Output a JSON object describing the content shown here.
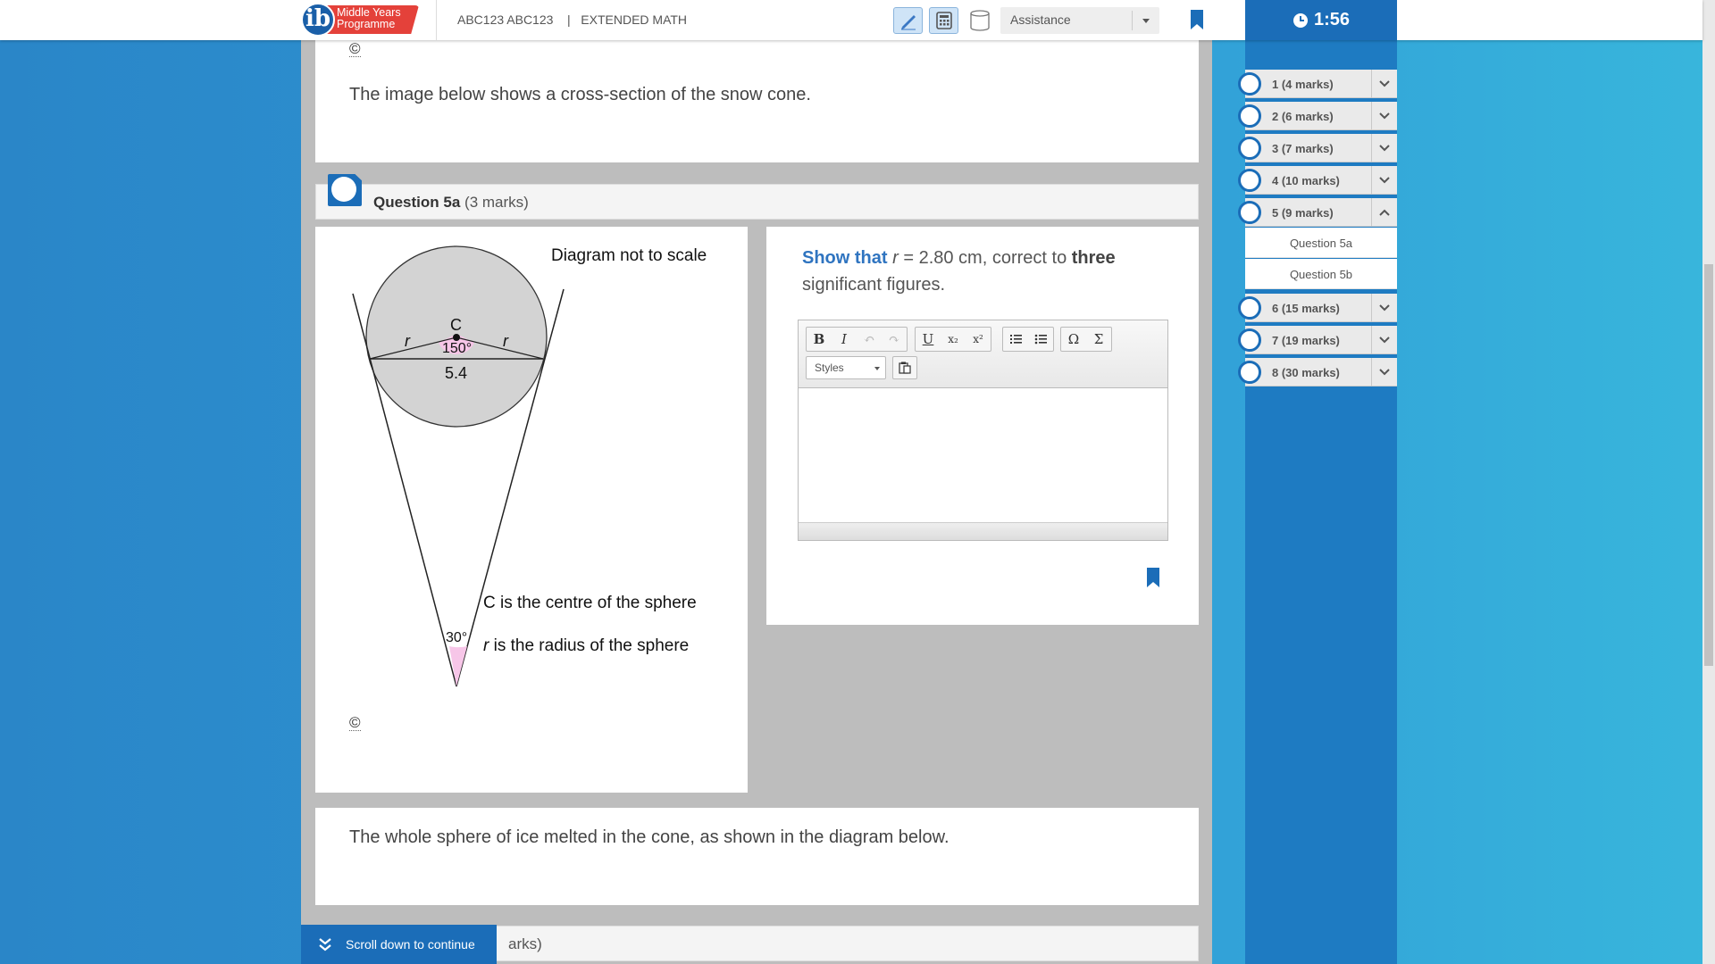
{
  "header": {
    "logo_letter": "ib",
    "logo_text": "Middle Years Programme",
    "candidate": "ABC123 ABC123",
    "separator": "|",
    "subject": "EXTENDED MATH",
    "assistance_label": "Assistance",
    "timer": "1:56",
    "icons": [
      "pen-icon",
      "calculator-icon",
      "formula-booklet-icon",
      "bookmark-icon",
      "clock-icon"
    ]
  },
  "content": {
    "copyright_symbol": "©",
    "intro_text": "The image below shows a cross-section of the snow cone.",
    "question": {
      "title": "Question 5a",
      "marks": "(3 marks)",
      "prompt_show": "Show that",
      "prompt_r": "r",
      "prompt_mid": " = 2.80 cm, correct to ",
      "prompt_bold": "three",
      "prompt_end": " significant figures."
    },
    "diagram": {
      "note": "Diagram not to scale",
      "center_label": "C",
      "radius_label": "r",
      "angle_top": "150°",
      "chord": "5.4",
      "angle_bottom": "30°",
      "legend_c": "C is the centre of the sphere",
      "legend_r_var": "r",
      "legend_r": " is the radius of the sphere"
    },
    "editor": {
      "buttons": [
        "B",
        "I",
        "↶",
        "↷",
        "U",
        "x₂",
        "x²",
        "Ω",
        "Σ"
      ],
      "styles_label": "Styles"
    },
    "melt_text": "The whole sphere of ice melted in the cone, as shown in the diagram below.",
    "next_question_partial": "arks)",
    "scroll_label": "Scroll down to continue"
  },
  "sidebar": {
    "items": [
      {
        "label": "1 (4 marks)",
        "expanded": false
      },
      {
        "label": "2 (6 marks)",
        "expanded": false
      },
      {
        "label": "3 (7 marks)",
        "expanded": false
      },
      {
        "label": "4 (10 marks)",
        "expanded": false
      },
      {
        "label": "5 (9 marks)",
        "expanded": true
      },
      {
        "label": "6 (15 marks)",
        "expanded": false
      },
      {
        "label": "7 (19 marks)",
        "expanded": false
      },
      {
        "label": "8 (30 marks)",
        "expanded": false
      }
    ],
    "subitems": [
      "Question 5a",
      "Question 5b"
    ]
  },
  "colors": {
    "primary_blue": "#1b6db8",
    "accent_red": "#e4413a",
    "angle_pink": "#f7c6e8",
    "sphere_gray": "#d3d3d3"
  }
}
